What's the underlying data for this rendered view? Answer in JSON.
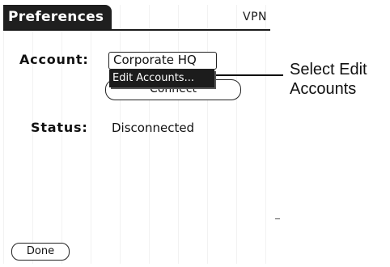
{
  "title_bar": {
    "title": "Preferences",
    "right_label": "VPN"
  },
  "form": {
    "account_label": "Account:",
    "account_value": "Corporate HQ",
    "popup_item": "Edit Accounts...",
    "connect_label": "Connect",
    "status_label": "Status:",
    "status_value": "Disconnected"
  },
  "footer": {
    "done_label": "Done"
  },
  "callout": {
    "line1": "Select Edit",
    "line2": "Accounts"
  }
}
